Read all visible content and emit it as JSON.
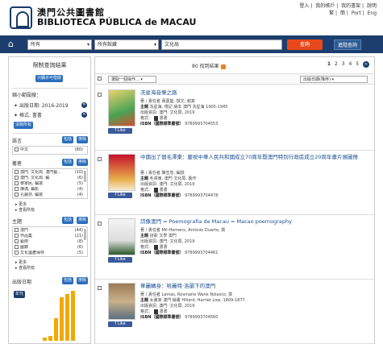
{
  "header": {
    "title_zh": "澳門公共圖書館",
    "title_pt": "BIBLIOTECA PÚBLICA de MACAU",
    "links": [
      "登入",
      "我的帳戶",
      "我的書架",
      "說明"
    ],
    "lang": [
      "繁",
      "簡",
      "Port",
      "Eng"
    ]
  },
  "search": {
    "scope": "所有",
    "location": "所有館藏",
    "query": "文化局",
    "button": "查詢",
    "advanced": "進階查詢"
  },
  "sidebar": {
    "title": "限制查詢結果",
    "save_btn": "只顯示可借閱",
    "narrowed_title": "縮小範圍搜：",
    "filters": [
      {
        "label": "出版日期: 2016-2019"
      },
      {
        "label": "格式: 書書"
      }
    ],
    "clear_btn": "清除所有",
    "lang_section": {
      "title": "語言",
      "include": "包括",
      "exclude": "排除",
      "items": [
        {
          "label": "中文",
          "count": "(80)"
        }
      ]
    },
    "author_section": {
      "title": "著者",
      "include": "包括",
      "exclude": "排除",
      "items": [
        {
          "label": "澳門. 文化局. 澳門藝...",
          "count": "(10)"
        },
        {
          "label": "澳門. 文化局. 編",
          "count": "(6)"
        },
        {
          "label": "黎家民, 編撰",
          "count": "(5)"
        },
        {
          "label": "陳滿, 攝影",
          "count": "(4)"
        },
        {
          "label": "孔麗芬, 編撰",
          "count": "(4)"
        }
      ],
      "more": "更多",
      "all": "查看所有"
    },
    "subject_section": {
      "title": "主題",
      "include": "包括",
      "exclude": "排除",
      "items": [
        {
          "label": "澳門",
          "count": "(44)"
        },
        {
          "label": "作品集",
          "count": "(21)"
        },
        {
          "label": "藝術",
          "count": "(8)"
        },
        {
          "label": "圖錄",
          "count": "(6)"
        },
        {
          "label": "文化遺產保存",
          "count": "(5)"
        }
      ],
      "more": "更多",
      "all": "查看所有"
    },
    "date_section": {
      "title": "出版日期",
      "include": "包括",
      "exclude": "排除",
      "toggle": "年代"
    }
  },
  "results": {
    "count_text": "80 找到結果",
    "pages": [
      "1",
      "2",
      "3",
      "4",
      "5"
    ],
    "next": ">",
    "bulk_select": "選取一個操作...",
    "sort": "出版日期(降序)",
    "items": [
      {
        "title": "冼星海音樂之路",
        "author": "黃葉能, 撰文; 謝其",
        "subject": "冼星海, 傳記 繪本 澳門 冼星海 1905-1945",
        "publisher": "澳門: 文化局, 2019",
        "format": "書書",
        "isbn": "9789993704553",
        "fb": "Like"
      },
      {
        "title": "中國出了個毛澤東：慶祝中華人民共和國成立70周年暨澳門特別行政區成立20周年畫片展圖冊",
        "author": "陳志忠, 編撰",
        "subject": "毛澤東, 澳門 文化局, 製作",
        "publisher": "澳門: 文化局, 2019",
        "format": "書書",
        "isbn": "9789993704478",
        "fb": "Like"
      },
      {
        "title": "詩像澳門 = Poemografia de Macau = Macao poemography",
        "author": "Mil-Homens, António Duarte, 撰",
        "subject": "詩歌 文學 澳門",
        "publisher": "澳門: 文化局, 2019",
        "format": "書書",
        "isbn": "9789993704461",
        "fb": "Like"
      },
      {
        "title": "華麗轉身：哈麗特·洛蘭下的澳門",
        "author": "Lamas, Rosmarie Wank Nolasco, 撰",
        "subject": "女畫家 澳門 繪畫 Hillard, Harriet Low, 1809-1877",
        "publisher": "澳門: 文化局, 2019",
        "format": "書書",
        "isbn": "9789993704560",
        "fb": "Like"
      }
    ],
    "labels": {
      "author": "著 / 責任者",
      "subject": "主題",
      "publisher": "出版資訊",
      "format": "格式：",
      "isbn": "ISBN（國際標準書號）"
    }
  },
  "date_chart": {
    "type": "bar",
    "values": [
      4,
      6,
      30,
      58,
      62,
      66
    ]
  },
  "colors": {
    "nav": "#1c3e6e",
    "search_button": "#e8481c",
    "link": "#1a4d8f",
    "chart_bar": "#f2a900"
  }
}
